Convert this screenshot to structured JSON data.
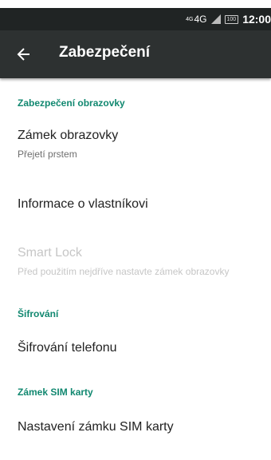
{
  "status_bar": {
    "network": "4G",
    "network_prefix": "4G",
    "battery": "100",
    "time": "12:00"
  },
  "app_bar": {
    "title": "Zabezpečení",
    "back_icon": "arrow-left-icon"
  },
  "sections": {
    "screen_security": {
      "header": "Zabezpečení obrazovky",
      "screen_lock": {
        "title": "Zámek obrazovky",
        "summary": "Přejetí prstem"
      },
      "owner_info": {
        "title": "Informace o vlastníkovi"
      },
      "smart_lock": {
        "title": "Smart Lock",
        "summary": "Před použitím nejdříve nastavte zámek obrazovky"
      }
    },
    "encryption": {
      "header": "Šifrování",
      "encrypt_phone": {
        "title": "Šifrování telefonu"
      }
    },
    "sim_lock": {
      "header": "Zámek SIM karty",
      "sim_lock_settings": {
        "title": "Nastavení zámku SIM karty"
      }
    }
  },
  "colors": {
    "accent": "#118870",
    "appbar": "#2d3131",
    "statusbar": "#202424"
  }
}
